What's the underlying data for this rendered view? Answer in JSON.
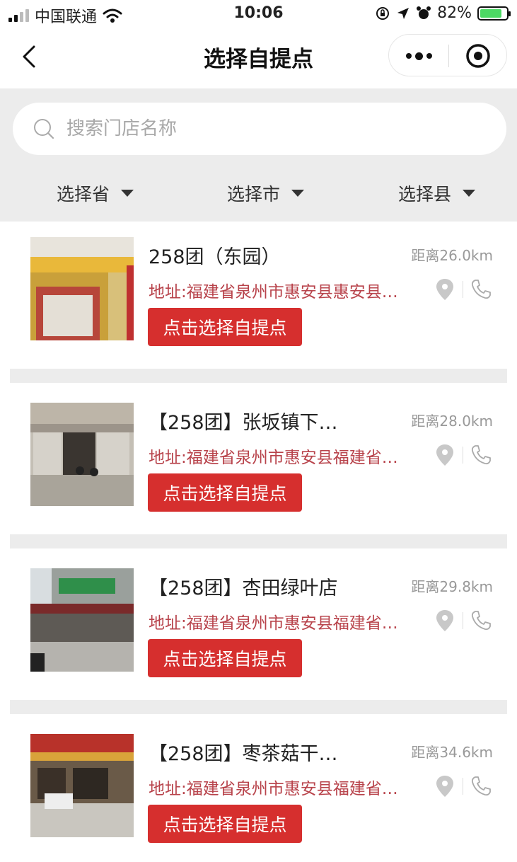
{
  "status_bar": {
    "carrier": "中国联通",
    "time": "10:06",
    "battery": "82%",
    "battery_level": 0.82
  },
  "nav": {
    "title": "选择自提点"
  },
  "search": {
    "placeholder": "搜索门店名称"
  },
  "filters": [
    {
      "label": "选择省"
    },
    {
      "label": "选择市"
    },
    {
      "label": "选择县"
    }
  ],
  "stores": [
    {
      "name": "258团（东园）",
      "distance": "距离26.0km",
      "address": "地址:福建省泉州市惠安县惠安县…",
      "button": "点击选择自提点"
    },
    {
      "name": "【258团】张坂镇下…",
      "distance": "距离28.0km",
      "address": "地址:福建省泉州市惠安县福建省…",
      "button": "点击选择自提点"
    },
    {
      "name": "【258团】杏田绿叶店",
      "distance": "距离29.8km",
      "address": "地址:福建省泉州市惠安县福建省…",
      "button": "点击选择自提点"
    },
    {
      "name": "【258团】枣茶菇干…",
      "distance": "距离34.6km",
      "address": "地址:福建省泉州市惠安县福建省…",
      "button": "点击选择自提点"
    }
  ],
  "colors": {
    "accent": "#d62f2e",
    "address": "#b8434b",
    "background": "#ececec"
  }
}
